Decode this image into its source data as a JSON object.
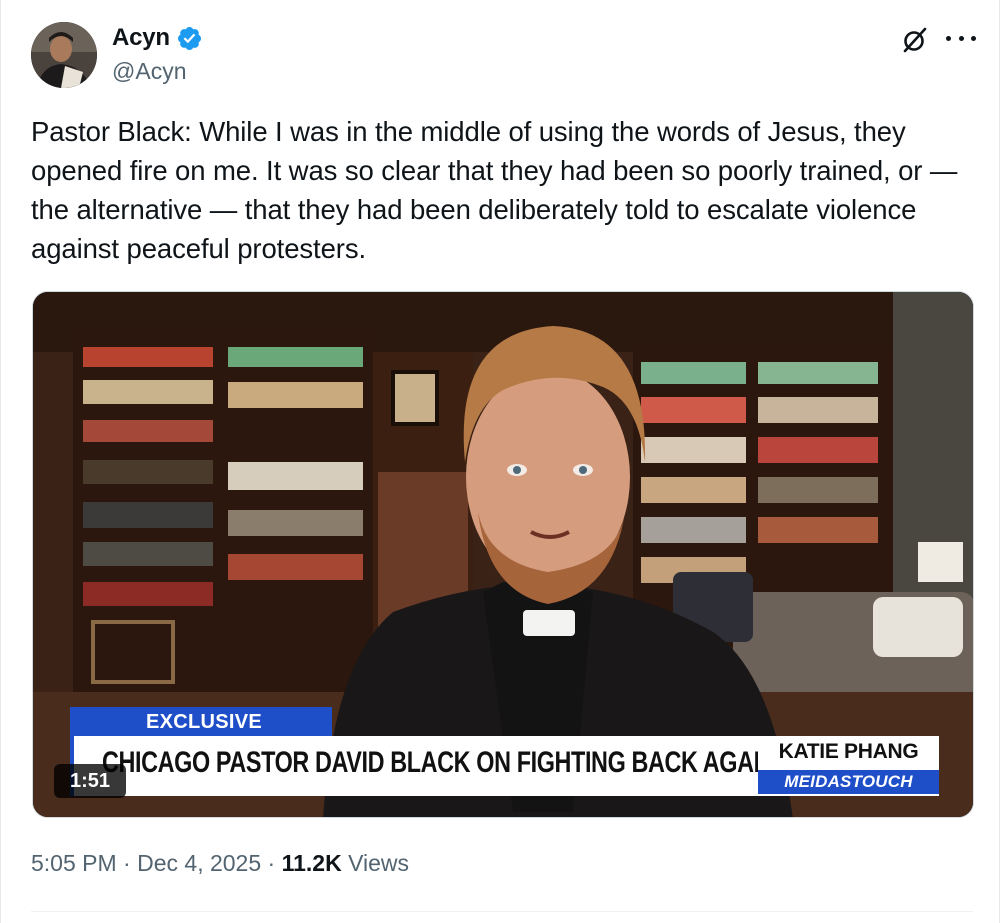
{
  "author": {
    "display_name": "Acyn",
    "handle": "@Acyn",
    "verified": true,
    "avatar_icon": "profile-photo"
  },
  "header_icons": [
    "grok-icon",
    "more-options-icon"
  ],
  "tweet": {
    "text": "Pastor Black: While I was in the middle of using the words of Jesus, they opened fire on me. It was so clear that they had been so poorly trained, or — the alternative — that they had been deliberately told to escalate violence against peaceful protesters."
  },
  "video": {
    "duration": "1:51",
    "chyron": {
      "tag": "EXCLUSIVE",
      "headline": "CHICAGO PASTOR DAVID BLACK ON FIGHTING BACK AGAINST ICE",
      "host": "KATIE PHANG",
      "network": "MEIDASTOUCH"
    }
  },
  "meta": {
    "time": "5:05 PM",
    "separator": "·",
    "date": "Dec 4, 2025",
    "views_count": "11.2K",
    "views_label": "Views"
  },
  "colors": {
    "text_primary": "#0f1419",
    "text_secondary": "#536471",
    "verified_blue": "#1d9bf0",
    "chyron_blue": "#1f4ec9"
  }
}
